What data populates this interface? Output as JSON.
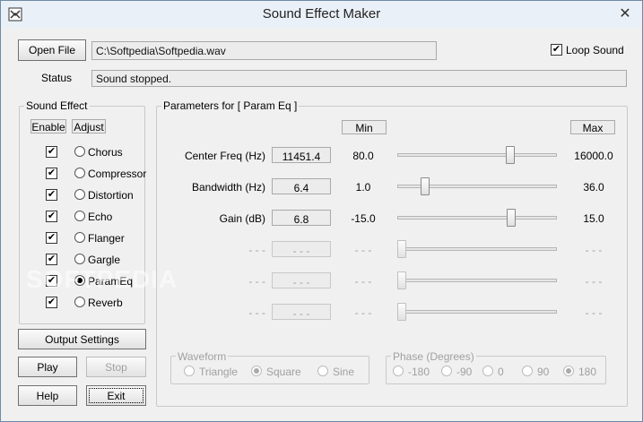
{
  "window": {
    "title": "Sound Effect Maker",
    "close": "✕"
  },
  "file": {
    "open_label": "Open File",
    "path": "C:\\Softpedia\\Softpedia.wav",
    "loop_label": "Loop Sound",
    "loop_checked": true
  },
  "status": {
    "label": "Status",
    "value": "Sound stopped."
  },
  "effects": {
    "group_title": "Sound Effect",
    "enable_header": "Enable",
    "adjust_header": "Adjust",
    "items": [
      {
        "label": "Chorus",
        "enabled": true,
        "selected": false
      },
      {
        "label": "Compressor",
        "enabled": true,
        "selected": false
      },
      {
        "label": "Distortion",
        "enabled": true,
        "selected": false
      },
      {
        "label": "Echo",
        "enabled": true,
        "selected": false
      },
      {
        "label": "Flanger",
        "enabled": true,
        "selected": false
      },
      {
        "label": "Gargle",
        "enabled": true,
        "selected": false
      },
      {
        "label": "ParamEq",
        "enabled": true,
        "selected": true
      },
      {
        "label": "Reverb",
        "enabled": true,
        "selected": false
      }
    ]
  },
  "buttons": {
    "output_settings": "Output Settings",
    "play": "Play",
    "stop": "Stop",
    "help": "Help",
    "exit": "Exit"
  },
  "params": {
    "group_title": "Parameters for [ Param Eq ]",
    "min_header": "Min",
    "max_header": "Max",
    "rows": [
      {
        "label": "Center Freq (Hz)",
        "value": "11451.4",
        "min": "80.0",
        "max": "16000.0",
        "level": 0.72,
        "disabled": false
      },
      {
        "label": "Bandwidth (Hz)",
        "value": "6.4",
        "min": "1.0",
        "max": "36.0",
        "level": 0.155,
        "disabled": false
      },
      {
        "label": "Gain (dB)",
        "value": "6.8",
        "min": "-15.0",
        "max": "15.0",
        "level": 0.727,
        "disabled": false
      },
      {
        "label": "- - -",
        "value": "- - -",
        "min": "- - -",
        "max": "- - -",
        "level": 0.0,
        "disabled": true
      },
      {
        "label": "- - -",
        "value": "- - -",
        "min": "- - -",
        "max": "- - -",
        "level": 0.0,
        "disabled": true
      },
      {
        "label": "- - -",
        "value": "- - -",
        "min": "- - -",
        "max": "- - -",
        "level": 0.0,
        "disabled": true
      }
    ]
  },
  "waveform": {
    "group_title": "Waveform",
    "options": [
      {
        "label": "Triangle",
        "selected": false
      },
      {
        "label": "Square",
        "selected": true
      },
      {
        "label": "Sine",
        "selected": false
      }
    ]
  },
  "phase": {
    "group_title": "Phase (Degrees)",
    "options": [
      {
        "label": "-180",
        "selected": false
      },
      {
        "label": "-90",
        "selected": false
      },
      {
        "label": "0",
        "selected": false
      },
      {
        "label": "90",
        "selected": false
      },
      {
        "label": "180",
        "selected": true
      }
    ]
  },
  "watermark": "SOFTPEDIA"
}
